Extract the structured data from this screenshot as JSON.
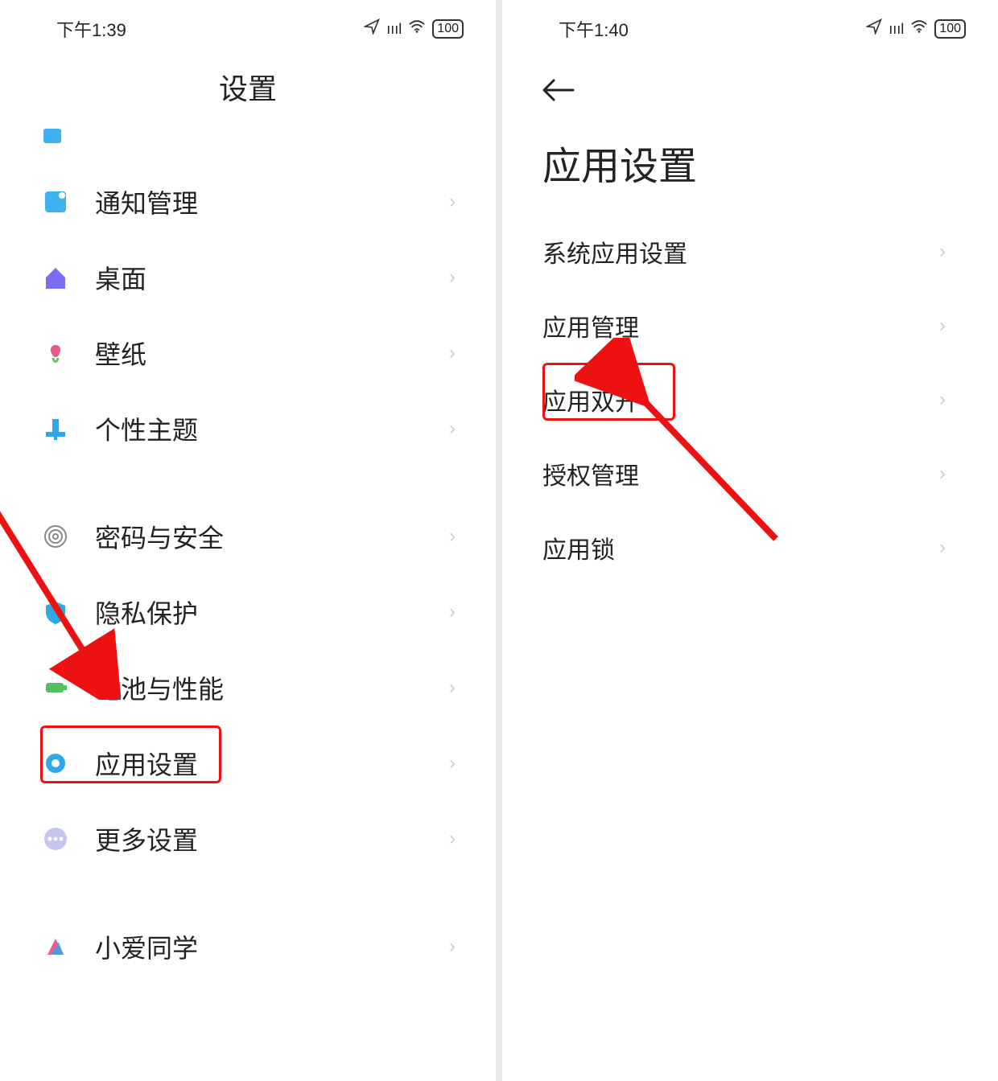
{
  "left": {
    "status": {
      "time": "下午1:39",
      "battery": "100"
    },
    "header": "设置",
    "items": [
      {
        "key": "notify",
        "label": "通知管理",
        "icon": "notify"
      },
      {
        "key": "home",
        "label": "桌面",
        "icon": "home"
      },
      {
        "key": "wallpaper",
        "label": "壁纸",
        "icon": "wallpaper"
      },
      {
        "key": "theme",
        "label": "个性主题",
        "icon": "theme"
      },
      {
        "key": "gap1",
        "label": "",
        "icon": ""
      },
      {
        "key": "security",
        "label": "密码与安全",
        "icon": "security"
      },
      {
        "key": "privacy",
        "label": "隐私保护",
        "icon": "privacy"
      },
      {
        "key": "battery",
        "label": "电池与性能",
        "icon": "battery"
      },
      {
        "key": "apps",
        "label": "应用设置",
        "icon": "apps"
      },
      {
        "key": "more",
        "label": "更多设置",
        "icon": "more"
      },
      {
        "key": "gap2",
        "label": "",
        "icon": ""
      },
      {
        "key": "xiaoai",
        "label": "小爱同学",
        "icon": "xiaoai"
      }
    ]
  },
  "right": {
    "status": {
      "time": "下午1:40",
      "battery": "100"
    },
    "title": "应用设置",
    "items": [
      {
        "key": "sysapps",
        "label": "系统应用设置"
      },
      {
        "key": "appmgr",
        "label": "应用管理"
      },
      {
        "key": "dualapps",
        "label": "应用双开"
      },
      {
        "key": "permmgr",
        "label": "授权管理"
      },
      {
        "key": "applock",
        "label": "应用锁"
      }
    ]
  }
}
